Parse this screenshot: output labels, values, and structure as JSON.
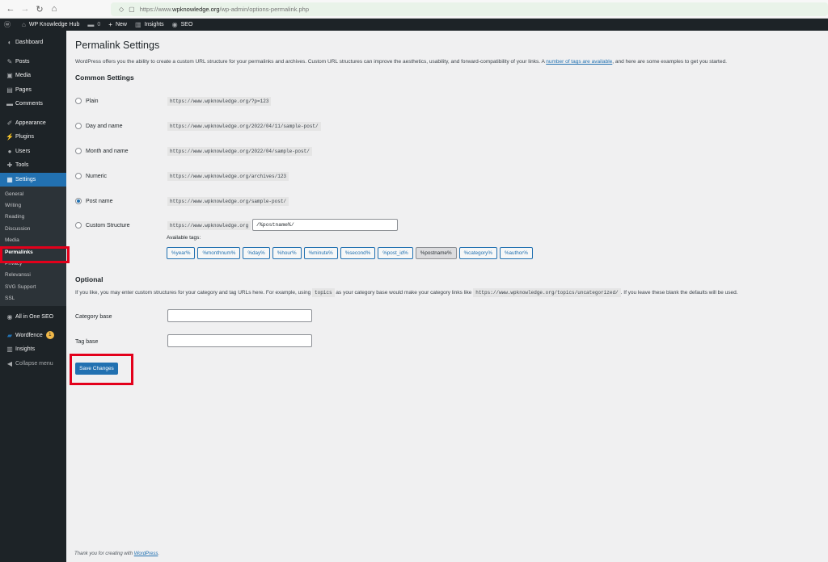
{
  "browser": {
    "url_prefix": "https://www.",
    "url_domain": "wpknowledge.org",
    "url_path": "/wp-admin/options-permalink.php"
  },
  "admin_bar": {
    "site_name": "WP Knowledge Hub",
    "comments_count": "0",
    "new_label": "New",
    "insights_label": "Insights",
    "seo_label": "SEO"
  },
  "sidebar": {
    "items_top": [
      {
        "icon": "dashboard-icon",
        "glyph": "◐",
        "label": "Dashboard"
      },
      {
        "icon": "pin-icon",
        "glyph": "✎",
        "label": "Posts"
      },
      {
        "icon": "media-icon",
        "glyph": "▣",
        "label": "Media"
      },
      {
        "icon": "pages-icon",
        "glyph": "▤",
        "label": "Pages"
      },
      {
        "icon": "comments-icon",
        "glyph": "▬",
        "label": "Comments"
      },
      {
        "icon": "appearance-icon",
        "glyph": "✐",
        "label": "Appearance"
      },
      {
        "icon": "plugins-icon",
        "glyph": "⚡",
        "label": "Plugins"
      },
      {
        "icon": "users-icon",
        "glyph": "●",
        "label": "Users"
      },
      {
        "icon": "tools-icon",
        "glyph": "✚",
        "label": "Tools"
      },
      {
        "icon": "settings-icon",
        "glyph": "▦",
        "label": "Settings"
      }
    ],
    "submenu": [
      "General",
      "Writing",
      "Reading",
      "Discussion",
      "Media",
      "Permalinks",
      "Privacy",
      "Relevanssi",
      "SVG Support",
      "SSL"
    ],
    "items_bottom": [
      {
        "icon": "aioseo-icon",
        "glyph": "◉",
        "label": "All in One SEO"
      },
      {
        "icon": "wordfence-icon",
        "glyph": "▰",
        "label": "Wordfence",
        "badge": "1"
      },
      {
        "icon": "insights-icon",
        "glyph": "▥",
        "label": "Insights"
      },
      {
        "icon": "collapse-icon",
        "glyph": "◀",
        "label": "Collapse menu"
      }
    ]
  },
  "main": {
    "title": "Permalink Settings",
    "intro_before": "WordPress offers you the ability to create a custom URL structure for your permalinks and archives. Custom URL structures can improve the aesthetics, usability, and forward-compatibility of your links. A ",
    "intro_link": "number of tags are available",
    "intro_after": ", and here are some examples to get you started.",
    "common_heading": "Common Settings",
    "options": [
      {
        "label": "Plain",
        "example": "https://www.wpknowledge.org/?p=123",
        "checked": false
      },
      {
        "label": "Day and name",
        "example": "https://www.wpknowledge.org/2022/04/11/sample-post/",
        "checked": false
      },
      {
        "label": "Month and name",
        "example": "https://www.wpknowledge.org/2022/04/sample-post/",
        "checked": false
      },
      {
        "label": "Numeric",
        "example": "https://www.wpknowledge.org/archives/123",
        "checked": false
      },
      {
        "label": "Post name",
        "example": "https://www.wpknowledge.org/sample-post/",
        "checked": true
      },
      {
        "label": "Custom Structure",
        "example": "https://www.wpknowledge.org",
        "checked": false
      }
    ],
    "custom_value": "/%postname%/",
    "available_tags_label": "Available tags:",
    "tags": [
      "%year%",
      "%monthnum%",
      "%day%",
      "%hour%",
      "%minute%",
      "%second%",
      "%post_id%",
      "%postname%",
      "%category%",
      "%author%"
    ],
    "active_tag": "%postname%",
    "optional_heading": "Optional",
    "optional_before": "If you like, you may enter custom structures for your category and tag URLs here. For example, using ",
    "optional_code1": "topics",
    "optional_mid": " as your category base would make your category links like ",
    "optional_code2": "https://www.wpknowledge.org/topics/uncategorized/",
    "optional_after": ". If you leave these blank the defaults will be used.",
    "category_base_label": "Category base",
    "category_base_value": "",
    "tag_base_label": "Tag base",
    "tag_base_value": "",
    "save_label": "Save Changes"
  },
  "footer": {
    "text": "Thank you for creating with ",
    "link": "WordPress",
    "end": "."
  },
  "colors": {
    "admin_dark": "#1d2327",
    "accent": "#2271b1",
    "highlight_box": "#e3001b"
  }
}
